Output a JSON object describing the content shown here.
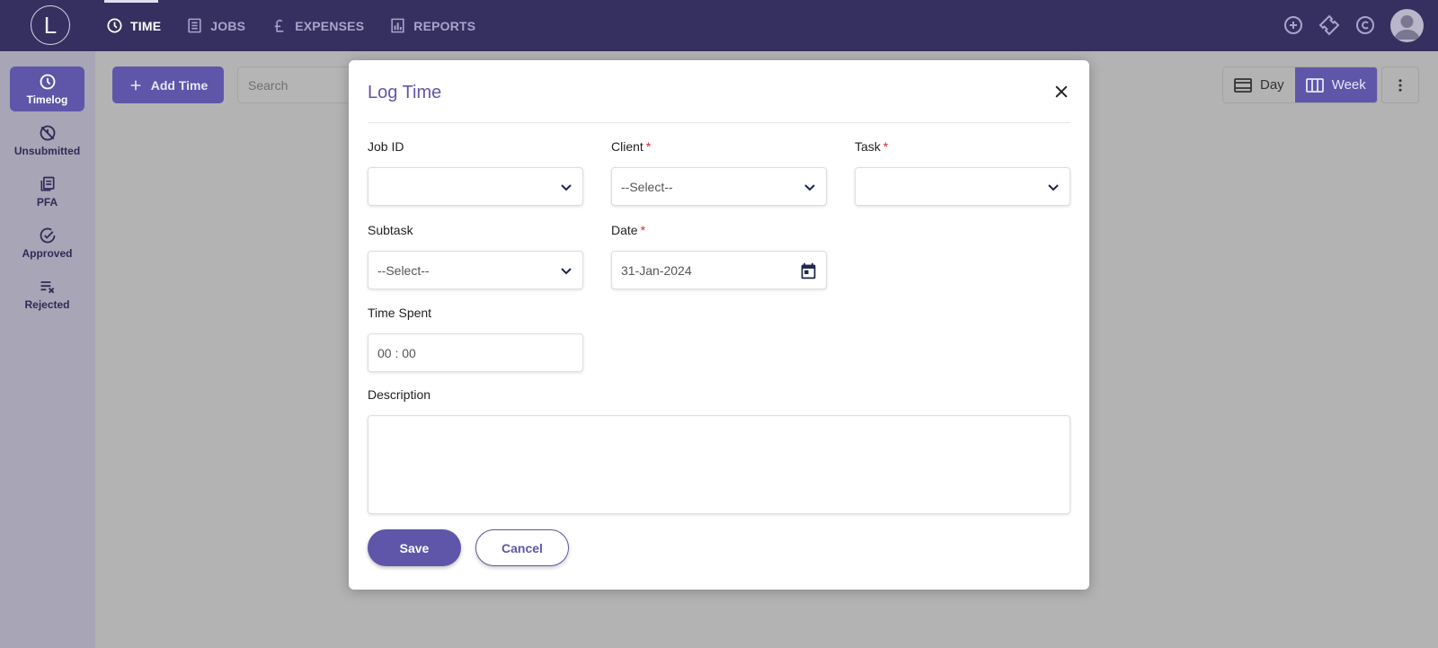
{
  "app": {
    "logo_letter": "L"
  },
  "nav": [
    {
      "label": "TIME",
      "icon": "clock-icon",
      "active": true
    },
    {
      "label": "JOBS",
      "icon": "list-icon",
      "active": false
    },
    {
      "label": "EXPENSES",
      "icon": "pound-icon",
      "active": false
    },
    {
      "label": "REPORTS",
      "icon": "bar-chart-icon",
      "active": false
    }
  ],
  "top_icons": [
    "add-circle-icon",
    "ticket-icon",
    "currency-c-icon",
    "avatar-icon"
  ],
  "sidebar": [
    {
      "label": "Timelog",
      "icon": "clock-icon",
      "active": true
    },
    {
      "label": "Unsubmitted",
      "icon": "no-time-icon",
      "active": false
    },
    {
      "label": "PFA",
      "icon": "pages-icon",
      "active": false
    },
    {
      "label": "Approved",
      "icon": "check-circle-icon",
      "active": false
    },
    {
      "label": "Rejected",
      "icon": "list-x-icon",
      "active": false
    }
  ],
  "toolbar": {
    "add_label": "Add Time",
    "search_placeholder": "Search",
    "view_day": "Day",
    "view_week": "Week"
  },
  "modal": {
    "title": "Log Time",
    "fields": {
      "job_id": {
        "label": "Job ID",
        "value": ""
      },
      "client": {
        "label": "Client",
        "required": "*",
        "value": "--Select--"
      },
      "task": {
        "label": "Task",
        "required": "*",
        "value": ""
      },
      "subtask": {
        "label": "Subtask",
        "value": "--Select--"
      },
      "date": {
        "label": "Date",
        "required": "*",
        "value": "31-Jan-2024"
      },
      "time_spent": {
        "label": "Time Spent",
        "value": "00 : 00"
      },
      "description": {
        "label": "Description",
        "value": ""
      }
    },
    "save_label": "Save",
    "cancel_label": "Cancel"
  },
  "colors": {
    "topbar": "#35305f",
    "accent": "#5f56a9",
    "required": "#e0262b"
  }
}
